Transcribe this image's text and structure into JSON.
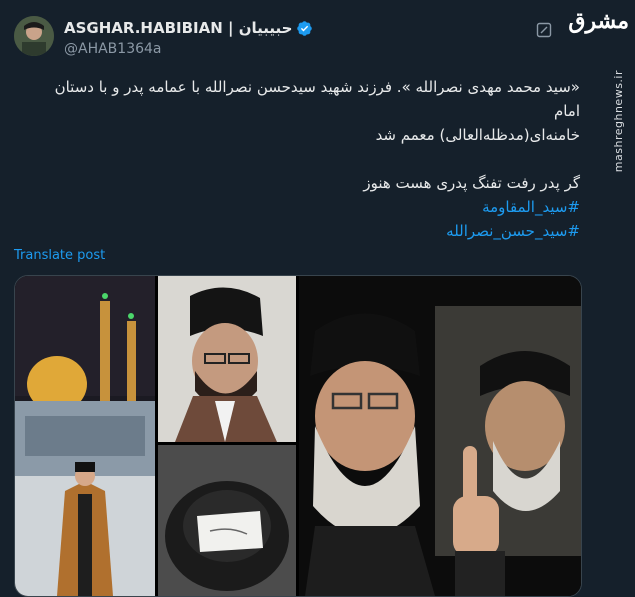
{
  "author": {
    "display_name": "ASGHAR.HABIBIAN | حبیبیان",
    "handle": "@AHAB1364a"
  },
  "tweet": {
    "lines": [
      "«سید محمد مهدی نصرالله ». فرزند شهید سیدحسن نصرالله با عمامه پدر و با دستان",
      "امام",
      "خامنه‌ای(مدظله‌العالی) معمم شد",
      "",
      "گر پدر رفت تفنگ پدری هست هنوز"
    ],
    "hashtags": [
      "#سید_المقاومة",
      "#سید_حسن_نصرالله"
    ],
    "translate_label": "Translate post"
  },
  "watermark": {
    "logo_text": "مشرق",
    "site": "mashreghnews.ir"
  },
  "icons": {
    "verified": "verified-badge-icon",
    "grok": "grok-icon"
  },
  "colors": {
    "background": "#15202b",
    "accent": "#1d9bf0",
    "secondary_text": "#8b98a5"
  }
}
